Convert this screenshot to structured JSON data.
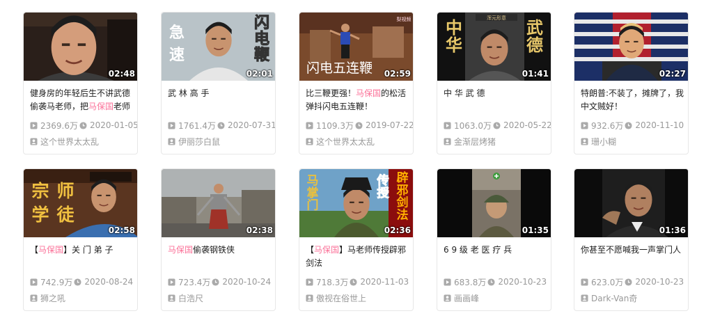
{
  "videos": [
    {
      "duration": "02:48",
      "title_pre": "健身房的年轻后生不讲武德偷袭马老师，把",
      "title_hl": "马保国",
      "title_post": "老师",
      "views": "2369.6万",
      "date": "2020-01-05",
      "uploader": "这个世界太太乱"
    },
    {
      "duration": "02:01",
      "title_pre": "武 林 高 手",
      "title_hl": "",
      "title_post": "",
      "views": "1761.4万",
      "date": "2020-07-31",
      "uploader": "伊丽莎白鼠"
    },
    {
      "duration": "02:59",
      "title_pre": "比三鞭更强！",
      "title_hl": "马保国",
      "title_post": "的松活弹抖闪电五连鞭！",
      "views": "1109.3万",
      "date": "2019-07-22",
      "uploader": "这个世界太太乱"
    },
    {
      "duration": "01:41",
      "title_pre": "中 华 武 德",
      "title_hl": "",
      "title_post": "",
      "views": "1063.0万",
      "date": "2020-05-22",
      "uploader": "金渐层烤猪"
    },
    {
      "duration": "02:27",
      "title_pre": "特朗普:不装了，摊牌了，我中文贼好！",
      "title_hl": "",
      "title_post": "",
      "views": "932.6万",
      "date": "2020-11-10",
      "uploader": "珊小糊"
    },
    {
      "duration": "02:58",
      "title_pre": "【",
      "title_hl": "马保国",
      "title_post": "】关 门 弟 子",
      "views": "742.9万",
      "date": "2020-08-24",
      "uploader": "狮之吼"
    },
    {
      "duration": "02:38",
      "title_pre": "",
      "title_hl": "马保国",
      "title_post": "偷袭钢铁侠",
      "views": "723.4万",
      "date": "2020-10-24",
      "uploader": "白浩尺"
    },
    {
      "duration": "02:36",
      "title_pre": "【",
      "title_hl": "马保国",
      "title_post": "】马老师传授辟邪剑法",
      "views": "718.3万",
      "date": "2020-11-03",
      "uploader": "傲视在俗世上"
    },
    {
      "duration": "01:35",
      "title_pre": "6 9 级 老 医 疗 兵",
      "title_hl": "",
      "title_post": "",
      "views": "683.8万",
      "date": "2020-10-23",
      "uploader": "画画峰"
    },
    {
      "duration": "01:36",
      "title_pre": "你甚至不愿喊我一声掌门人",
      "title_hl": "",
      "title_post": "",
      "views": "623.0万",
      "date": "2020-10-23",
      "uploader": "Dark-Van奇"
    }
  ],
  "thumb_text": {
    "v1_left": "急速",
    "v1_right": "闪电鞭",
    "v2_caption": "闪电五连鞭",
    "v2_logo": "梨视频",
    "v3_left": "中华",
    "v3_right": "武德",
    "v3_banner": "浑元形意",
    "v5_left": "宗师学徒",
    "v7_left": "马掌门",
    "v7_mid": "传授",
    "v7_right": "辟邪剑法"
  },
  "colors": {
    "highlight": "#fb7299",
    "meta": "#999999",
    "title": "#212121"
  },
  "icons": {
    "views": "play-count-icon",
    "date": "clock-icon",
    "uploader": "user-icon"
  }
}
